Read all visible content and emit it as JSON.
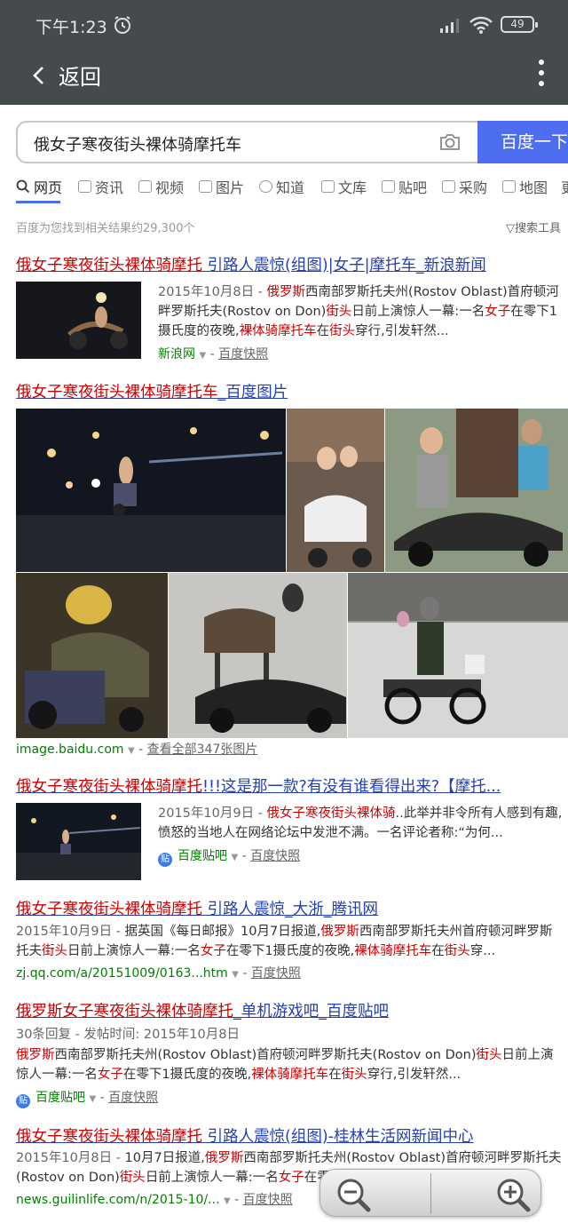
{
  "status": {
    "time": "下午1:23",
    "battery": "49"
  },
  "nav": {
    "back_label": "返回"
  },
  "search": {
    "query": "俄女子寒夜街头裸体骑摩托车",
    "button": "百度一下"
  },
  "tabs": [
    "网页",
    "资讯",
    "视频",
    "图片",
    "知道",
    "文库",
    "贴吧",
    "采购",
    "地图",
    "更"
  ],
  "stats": "百度为您找到相关结果约29,300个",
  "tools": "搜索工具",
  "results": [
    {
      "title_em": "俄女子寒夜街头裸体骑摩托",
      "title_rest": " 引路人震惊(组图)|女子|摩托车_新浪新闻",
      "date": "2015年10月8日 - ",
      "abstract": [
        [
          "俄罗斯",
          true
        ],
        [
          "西南部罗斯托夫州(Rostov Oblast)首府顿河畔罗斯托夫(Rostov on Don)",
          false
        ],
        [
          "街头",
          true
        ],
        [
          "日前上演惊人一幕:一名",
          false
        ],
        [
          "女子",
          true
        ],
        [
          "在零下1摄氏度的夜晚,",
          false
        ],
        [
          "裸体骑摩托车",
          true
        ],
        [
          "在",
          false
        ],
        [
          "街头",
          true
        ],
        [
          "穿行,引发轩然...",
          false
        ]
      ],
      "source": "新浪网",
      "snapshot": "百度快照"
    },
    {
      "title_em": "俄女子寒夜街头裸体骑摩托车",
      "title_rest": "_百度图片",
      "source": "image.baidu.com",
      "more": "查看全部347张图片"
    },
    {
      "title_em": "俄女子寒夜街头裸体骑摩托",
      "title_rest": "!!!这是那一款?有没有谁看得出来?【摩托...",
      "date": "2015年10月9日 - ",
      "abstract": [
        [
          "俄女子寒夜街头裸体骑",
          true
        ],
        [
          "..此举并非令所有人感到有趣,愤怒的当地人在网络论坛中发泄不满。一名评论者称:“为何...",
          false
        ]
      ],
      "source": "百度贴吧",
      "snapshot": "百度快照"
    },
    {
      "title_em": "俄女子寒夜街头裸体骑摩托",
      "title_rest": " 引路人震惊_大浙_腾讯网",
      "date": "2015年10月9日 - ",
      "abstract": [
        [
          "据英国《每日邮报》10月7日报道,",
          false
        ],
        [
          "俄罗斯",
          true
        ],
        [
          "西南部罗斯托夫州首府顿河畔罗斯托夫",
          false
        ],
        [
          "街头",
          true
        ],
        [
          "日前上演惊人一幕:一名",
          false
        ],
        [
          "女子",
          true
        ],
        [
          "在零下1摄氏度的夜晚,",
          false
        ],
        [
          "裸体骑摩托车",
          true
        ],
        [
          "在",
          false
        ],
        [
          "街头",
          true
        ],
        [
          "穿...",
          false
        ]
      ],
      "source": "zj.qq.com/a/20151009/0163...htm",
      "snapshot": "百度快照"
    },
    {
      "title_em": "俄罗斯女子寒夜街头裸体骑摩托",
      "title_rest": "_单机游戏吧_百度贴吧",
      "meta": "30条回复 - 发帖时间: 2015年10月8日",
      "abstract": [
        [
          "俄罗斯",
          true
        ],
        [
          "西南部罗斯托夫州(Rostov Oblast)首府顿河畔罗斯托夫(Rostov on Don)",
          false
        ],
        [
          "街头",
          true
        ],
        [
          "日前上演惊人一幕:一名",
          false
        ],
        [
          "女子",
          true
        ],
        [
          "在零下1摄氏度的夜晚,",
          false
        ],
        [
          "裸体骑摩托车",
          true
        ],
        [
          "在",
          false
        ],
        [
          "街头",
          true
        ],
        [
          "穿行,引发轩然...",
          false
        ]
      ],
      "source": "百度贴吧",
      "snapshot": "百度快照"
    },
    {
      "title_em": "俄女子寒夜街头裸体骑摩托",
      "title_rest": " 引路人震惊(组图)-桂林生活网新闻中心",
      "date": "2015年10月8日 - ",
      "abstract": [
        [
          "10月7日报道,",
          false
        ],
        [
          "俄罗斯",
          true
        ],
        [
          "西南部罗斯托夫州(Rostov Oblast)首府顿河畔罗斯托夫(Rostov on Don)",
          false
        ],
        [
          "街头",
          true
        ],
        [
          "日前上演惊人一幕:一名",
          false
        ],
        [
          "女子",
          true
        ],
        [
          "在零",
          false
        ]
      ],
      "source": "news.guilinlife.com/n/2015-10/...",
      "snapshot": "百度快照"
    }
  ],
  "colors": {
    "link": "#2440b3",
    "highlight": "#cc0000",
    "source_green": "#008000",
    "button_blue": "#4e6ef2",
    "topbar": "#454a4d"
  }
}
